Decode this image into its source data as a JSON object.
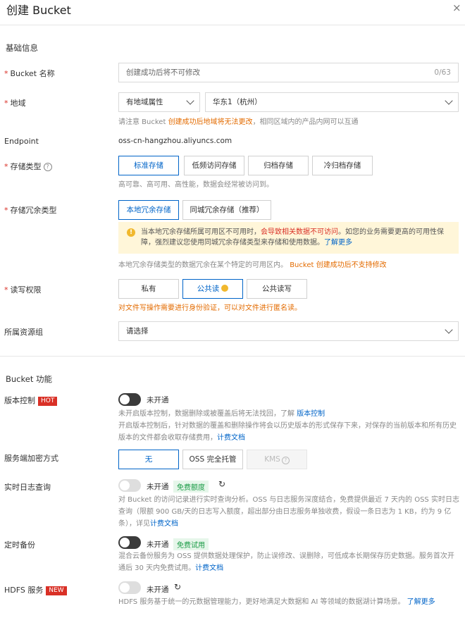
{
  "header": {
    "title": "创建 Bucket",
    "close": "×"
  },
  "basic": {
    "section": "基础信息",
    "name": {
      "label": "Bucket 名称",
      "placeholder": "创建成功后将不可修改",
      "counter": "0/63"
    },
    "region": {
      "label": "地域",
      "attr_value": "有地域属性",
      "region_value": "华东1（杭州）",
      "hint_prefix": "请注意 Bucket ",
      "hint_warn": "创建成功后地域将无法更改",
      "hint_suffix": "，相同区域内的产品内网可以互通"
    },
    "endpoint": {
      "label": "Endpoint",
      "value": "oss-cn-hangzhou.aliyuncs.com"
    },
    "storage_class": {
      "label": "存储类型",
      "options": [
        "标准存储",
        "低频访问存储",
        "归档存储",
        "冷归档存储"
      ],
      "hint": "高可靠、高可用、高性能，数据会经常被访问到。"
    },
    "redundancy": {
      "label": "存储冗余类型",
      "options": [
        "本地冗余存储",
        "同城冗余存储（推荐）"
      ],
      "notice_1": "当本地冗余存储所属可用区不可用时，",
      "notice_red": "会导致相关数据不可访问",
      "notice_2": "。如您的业务需要更高的可用性保障，强烈建议您使用同城冗余存储类型来存储和使用数据。",
      "notice_link": "了解更多",
      "hint_prefix": "本地冗余存储类型的数据冗余在某个特定的可用区内。",
      "hint_warn": "Bucket 创建成功后不支持修改"
    },
    "acl": {
      "label": "读写权限",
      "options": [
        "私有",
        "公共读",
        "公共读写"
      ],
      "hint": "对文件写操作需要进行身份验证，可以对文件进行匿名读。"
    },
    "resource_group": {
      "label": "所属资源组",
      "placeholder": "请选择"
    }
  },
  "features": {
    "section": "Bucket 功能",
    "versioning": {
      "label": "版本控制",
      "badge": "HOT",
      "state": "未开通",
      "desc_1": "未开启版本控制，数据删除或被覆盖后将无法找回，了解",
      "desc_1_link": "版本控制",
      "desc_2": "开启版本控制后，针对数据的覆盖和删除操作将会以历史版本的形式保存下来，对保存的当前版本和所有历史版本的文件都会收取存储费用，",
      "desc_2_link": "计费文档"
    },
    "encryption": {
      "label": "服务端加密方式",
      "options": [
        "无",
        "OSS 完全托管",
        "KMS"
      ]
    },
    "realtime_log": {
      "label": "实时日志查询",
      "state": "未开通",
      "tag": "免费额度",
      "desc": "对 Bucket 的访问记录进行实时查询分析。OSS 与日志服务深度结合，免费提供最近 7 天内的 OSS 实时日志查询（限额 900 GB/天的日志写入额度，超出部分由日志服务单独收费，假设一条日志为 1 KB，约为 9 亿条），详见",
      "desc_link": "计费文档"
    },
    "backup": {
      "label": "定时备份",
      "state": "未开通",
      "tag": "免费试用",
      "desc": "混合云备份服务为 OSS 提供数据处理保护，防止误修改、误删除，可低成本长期保存历史数据。服务首次开通后 30 天内免费试用。",
      "desc_link": "计费文档"
    },
    "hdfs": {
      "label": "HDFS 服务",
      "badge": "NEW",
      "state": "未开通",
      "desc": "HDFS 服务基于统一的元数据管理能力，更好地满足大数据和 AI 等领域的数据湖计算场景。",
      "desc_link": "了解更多"
    }
  },
  "colors": {
    "accent": "#0064c8",
    "danger": "#d93026",
    "warning": "#e36b00",
    "notice_bg": "#fff6d9"
  }
}
